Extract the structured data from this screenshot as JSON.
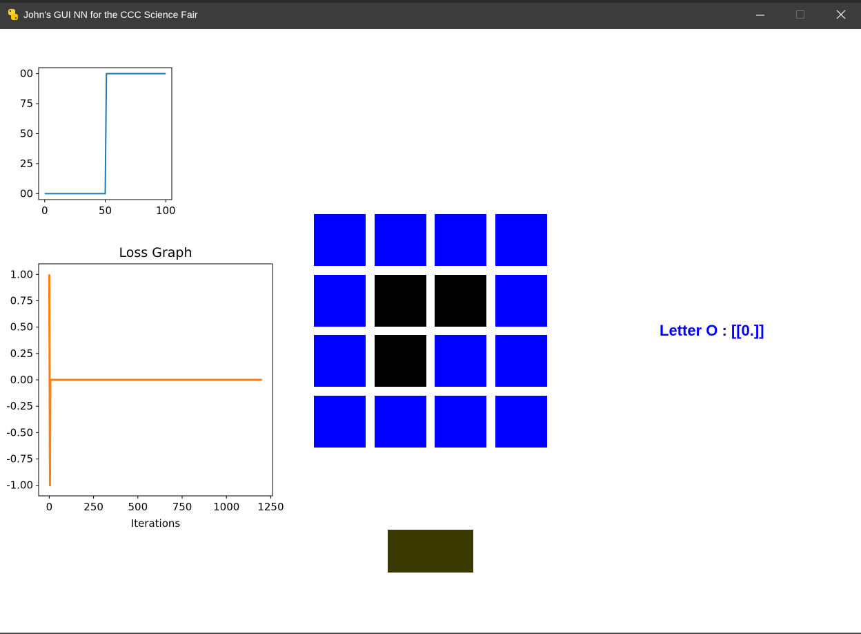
{
  "window": {
    "title": "John's GUI NN for the CCC Science Fair",
    "controls": [
      "minimize",
      "maximize",
      "close"
    ]
  },
  "colors": {
    "titlebar": "#3c3c3c",
    "cell_on": "#0000ff",
    "cell_off": "#000000",
    "result_text": "#0000ff",
    "action_box": "#3a3a00",
    "top_series": "#1f77b4",
    "loss_series": "#ff7f0e"
  },
  "grid": {
    "rows": 4,
    "cols": 4,
    "cells": [
      [
        "blue",
        "blue",
        "blue",
        "blue"
      ],
      [
        "blue",
        "black",
        "black",
        "blue"
      ],
      [
        "blue",
        "black",
        "blue",
        "blue"
      ],
      [
        "blue",
        "blue",
        "blue",
        "blue"
      ]
    ]
  },
  "result": {
    "label": "Letter O : [[0.]]"
  },
  "chart_data": [
    {
      "type": "line",
      "title": "",
      "xlabel": "",
      "ylabel": "",
      "xlim": [
        -5,
        105
      ],
      "ylim": [
        -5,
        105
      ],
      "x_ticks": [
        "0",
        "50",
        "100"
      ],
      "y_ticks": [
        "00",
        "25",
        "50",
        "75",
        "00"
      ],
      "series": [
        {
          "x": [
            0,
            50,
            51,
            100
          ],
          "y": [
            0,
            0,
            100,
            100
          ]
        }
      ],
      "grid": false
    },
    {
      "type": "line",
      "title": "Loss Graph",
      "xlabel": "Iterations",
      "ylabel": "",
      "xlim": [
        -60,
        1260
      ],
      "ylim": [
        -1.1,
        1.1
      ],
      "x_ticks": [
        "0",
        "250",
        "500",
        "750",
        "1000",
        "1250"
      ],
      "y_ticks": [
        "1.00",
        "0.75",
        "0.50",
        "0.25",
        "0.00",
        "-0.25",
        "-0.50",
        "-0.75",
        "-1.00"
      ],
      "series": [
        {
          "x": [
            0,
            2,
            4,
            6,
            8,
            10,
            1200
          ],
          "y": [
            1,
            0,
            -1,
            0,
            0,
            0,
            0
          ]
        }
      ],
      "grid": false
    }
  ]
}
